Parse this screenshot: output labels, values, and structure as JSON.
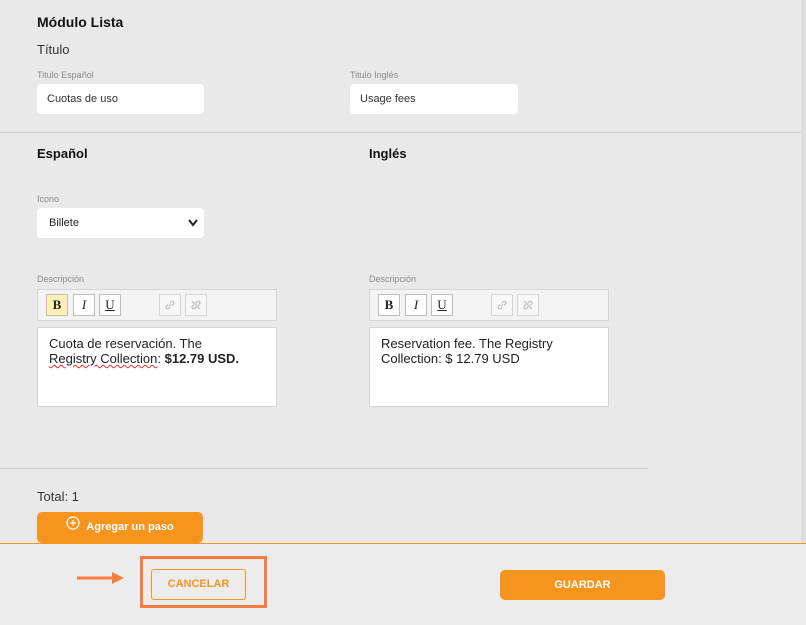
{
  "module": {
    "title": "Módulo Lista",
    "subtitle": "Título"
  },
  "titles": {
    "es_label": "Titulo Español",
    "es_value": "Cuotas de uso",
    "en_label": "Titulo Inglés",
    "en_value": "Usage fees"
  },
  "spanish": {
    "heading": "Español",
    "icon_label": "Icono",
    "icon_value": "Billete",
    "desc_label": "Descripción",
    "desc_text_1": "Cuota de reservación. The",
    "desc_text_2a": "Registry Collection",
    "desc_text_2b": ": ",
    "desc_text_2c": "$12.79 USD."
  },
  "english": {
    "heading": "Inglés",
    "desc_label": "Descripción",
    "desc_text_1": "Reservation fee. The Registry",
    "desc_text_2": "Collection: $ 12.79 USD"
  },
  "toolbar": {
    "bold": "B",
    "italic": "I",
    "underline": "U"
  },
  "footer": {
    "total": "Total: 1",
    "add_step": "Agregar un paso",
    "cancel": "CANCELAR",
    "save": "GUARDAR"
  },
  "colors": {
    "accent": "#f7941d",
    "highlight": "#fa7c3f",
    "background": "#e9e9e9"
  }
}
